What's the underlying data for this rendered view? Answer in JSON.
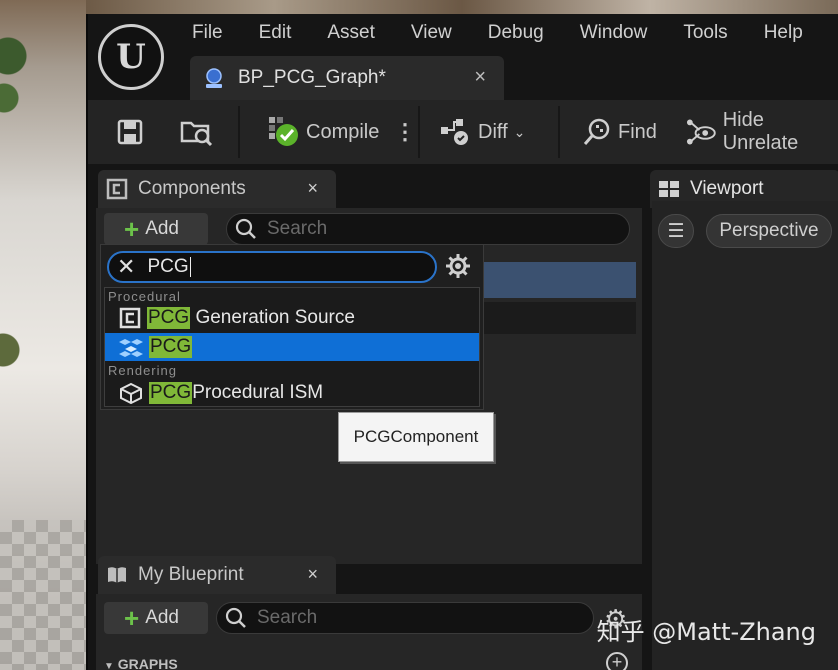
{
  "menu": [
    "File",
    "Edit",
    "Asset",
    "View",
    "Debug",
    "Window",
    "Tools",
    "Help"
  ],
  "document_tab": {
    "title": "BP_PCG_Graph*",
    "close": "×"
  },
  "toolbar": {
    "compile": "Compile",
    "diff": "Diff",
    "find": "Find",
    "hide_unrelated": "Hide Unrelate"
  },
  "components_panel": {
    "title": "Components",
    "close": "×",
    "add_label": "Add",
    "search_placeholder": "Search"
  },
  "add_dropdown": {
    "search_value": "PCG",
    "categories": {
      "procedural": "Procedural",
      "rendering": "Rendering"
    },
    "items": [
      {
        "highlight": "PCG",
        "rest": " Generation Source",
        "icon": "c-class-icon"
      },
      {
        "highlight": "PCG",
        "rest": "",
        "icon": "pcg-graph-icon",
        "selected": true
      },
      {
        "highlight": "PCG",
        "rest": "Procedural ISM",
        "icon": "cube-mesh-icon"
      }
    ]
  },
  "tooltip": "PCGComponent",
  "viewport_panel": {
    "title": "Viewport",
    "perspective": "Perspective"
  },
  "my_blueprint_panel": {
    "title": "My Blueprint",
    "close": "×",
    "add_label": "Add",
    "search_placeholder": "Search",
    "graphs_section": "GRAPHS"
  },
  "watermark": "知乎 @Matt-Zhang",
  "colors": {
    "selection": "#0f6fd6",
    "match_highlight": "#80b838",
    "add_plus": "#6cc24a",
    "focus_border": "#2a73c9"
  }
}
